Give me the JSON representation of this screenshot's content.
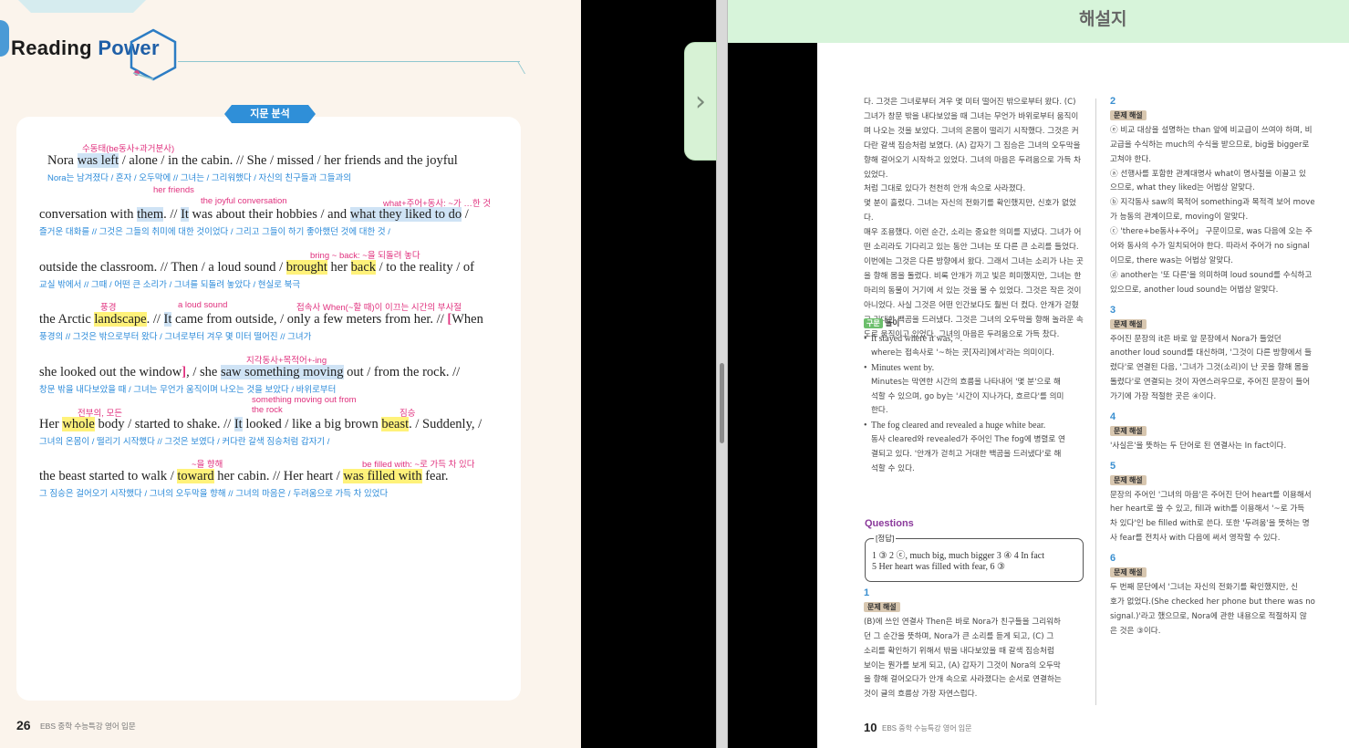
{
  "left_page": {
    "logo_reading": "Reading",
    "logo_power": "Power",
    "badge": "지문 분석",
    "lines": [
      {
        "note": "수동태(be동사+과거분사)",
        "eng": [
          "Nora ",
          "was left",
          " / alone / in the cabin. // She / missed / her friends and the joyful"
        ],
        "kor": "Nora는 남겨졌다 /          혼자 /       오두막에 //              그녀는 /  그리워했다 /   자신의 친구들과 그들과의"
      },
      {
        "note": "her friends",
        "note2": "the joyful conversation",
        "note3": "what+주어+동사: ~가 …한 것",
        "eng": [
          "conversation with ",
          "them",
          ". // ",
          "It",
          " was about their hobbies / and ",
          "what they liked to do",
          " /"
        ],
        "kor": "즐거운 대화를 //                           그것은 그들의 취미에 대한 것이었다 /              그리고 그들이 하기 좋아했던 것에 대한 것 /"
      },
      {
        "note": "bring ~ back: ~을 되돌려 놓다",
        "eng": [
          "outside the classroom. // Then / a loud sound / ",
          "brought",
          " her ",
          "back",
          " / to the reality / of"
        ],
        "kor": "교실 밖에서 //                        그때 /    어떤 큰 소리가 /          그녀를 되돌려 놓았다 /     현실로                        북극"
      },
      {
        "note": "풍경",
        "note2": "a loud sound",
        "note3": "접속사 When(~할 때)이 이끄는 시간의 부사절",
        "eng": [
          "the Arctic ",
          "landscape",
          ". // ",
          "It",
          " came from outside, / only a few meters from her. // ",
          "[",
          "When"
        ],
        "kor": "풍경의 //                                   그것은 밖으로부터 왔다 /          그녀로부터 겨우 몇 미터 떨어진 //                그녀가"
      },
      {
        "note": "지각동사+목적어+-ing",
        "eng": [
          "she looked out the window",
          "]",
          ", / she ",
          "saw something moving",
          " out / from the rock. //"
        ],
        "kor": "창문 밖을 내다보았을 때 /                          그녀는 무언가 움직이며 나오는 것을 보았다 /             바위로부터"
      },
      {
        "note": "전부의, 모든",
        "note2": "something moving out from the rock",
        "note3": "짐승",
        "eng": [
          "Her ",
          "whole",
          " body / started to shake. // ",
          "It",
          " looked / like a big brown ",
          "beast",
          ". / Suddenly, /"
        ],
        "kor": "그녀의 온몸이 /           떨리기 시작했다 //      그것은 보였다 /    커다란 갈색 짐승처럼                       갑자기 /"
      },
      {
        "note": "~을 향해",
        "note2": "be filled with: ~로 가득 차 있다",
        "eng": [
          "the beast started to walk / ",
          "toward",
          " her cabin. // Her heart / ",
          "was filled with",
          " fear."
        ],
        "kor": "그 짐승은 걸어오기 시작했다 /          그녀의 오두막을 향해 //          그녀의 마음은 /     두려움으로 가득 차 있었다"
      }
    ],
    "page_number": "26",
    "footer_text": "EBS 중학 수능특강 영어 입문"
  },
  "right_page": {
    "title": "해설지",
    "left_column": [
      "다. 그것은 그녀로부터 겨우 몇 미터 떨어진 밖으로부터 왔다. (C)",
      "그녀가 창문 밖을 내다보았을 때 그녀는 무언가 바위로부터 움직이",
      "며 나오는 것을 보았다. 그녀의 온몸이 떨리기 시작했다. 그것은 커",
      "다란 갈색 짐승처럼 보였다. (A) 갑자기 그 짐승은 그녀의 오두막을",
      "향해 걸어오기 시작하고 있었다. 그녀의 마음은 두려움으로 가득 차 있었다.",
      "처럼 그대로 있다가 천천히 안개 속으로 사라졌다.",
      "몇 분이 흘렀다. 그녀는 자신의 전화기를 확인했지만, 신호가 없었다.",
      "매우 조용했다. 이런 순간, 소리는 중요한 의미를 지녔다. 그녀가 어",
      "떤 소리라도 기다리고 있는 동안 그녀는 또 다른 큰 소리를 들었다.",
      "이번에는 그것은 다른 방향에서 왔다. 그래서 그녀는 소리가 나는 곳",
      "을 향해 몸을 돌렸다. 비록 안개가 끼고 빛은 희미했지만, 그녀는 한",
      "마리의 동물이 거기에 서 있는 것을 볼 수 있었다. 그것은 작은 것이",
      "아니었다. 사실 그것은 어떤 인간보다도 훨씬 더 컸다. 안개가 걷혔",
      "고 거대한 백곰을 드러냈다. 그것은 그녀의 오두막을 향해 놀라운 속",
      "도로 움직이고 있었다. 그녀의 마음은 두려움으로 가득 찼다."
    ],
    "gu_tag": "구문",
    "gu_title": "돌이",
    "gu_items": [
      {
        "head": "It stayed where it was, ~.",
        "body": [
          "where는 접속사로 '~하는 곳[자리]에서'라는 의미이다."
        ]
      },
      {
        "head": "Minutes went by.",
        "body": [
          "Minutes는 막연한 시간의 흐름을 나타내어 '몇 분'으로 해",
          "석할 수 있으며, go by는 '시간이 지나가다, 흐르다'를 의미",
          "한다."
        ]
      },
      {
        "head": "The fog cleared and revealed a huge white bear.",
        "body": [
          "동사 cleared와 revealed가 주어인 The fog에 병렬로 연",
          "결되고 있다. '안개가 걷히고 거대한 백곰을 드러냈다'로 해",
          "석할 수 있다."
        ]
      }
    ],
    "questions_title": "Questions",
    "answer_label": "[정답]",
    "answer_line_1": "1 ③  2 ⓒ, much big, much bigger  3 ④  4 In fact",
    "answer_line_2": "5 Her heart was filled with fear,  6 ③",
    "q1_number": "1",
    "q1_tag": "문제 해설",
    "q1_lines": [
      "(B)에 쓰인 연결사 Then은 바로 Nora가 친구들을 그리워하",
      "던 그 순간을 뜻하며, Nora가 큰 소리를 듣게 되고, (C) 그",
      "소리를 확인하기 위해서 밖을 내다보았을 때 갈색 짐승처럼",
      "보이는 뭔가를 보게 되고, (A) 갑자기 그것이 Nora의 오두막",
      "을 향해 걸어오다가 안개 속으로 사라졌다는 순서로 연결하는",
      "것이 글의 흐름상 가장 자연스럽다."
    ],
    "right_column": [
      {
        "num": "2",
        "tag": "문제 해설",
        "lines": [
          "ⓔ 비교 대상을 설명하는 than 앞에 비교급이 쓰여야 하며, 비",
          "교급을 수식하는 much의 수식을 받으므로, big을 bigger로",
          "고쳐야 한다.",
          "ⓐ 선행사를 포함한 관계대명사 what이 명사절을 이끌고 있",
          "으므로, what they liked는 어법상 알맞다.",
          "ⓑ 지각동사 saw의 목적어 something과 목적격 보어 move",
          "가 능동의 관계이므로, moving이 알맞다.",
          "ⓒ 'there+be동사+주어」 구문이므로, was 다음에 오는 주",
          "어와 동사의 수가 일치되어야 한다. 따라서 주어가 no signal",
          "이므로, there was는 어법상 알맞다.",
          "ⓓ another는 '또 다른'을 의미하며 loud sound를 수식하고",
          "있으므로, another loud sound는 어법상 알맞다."
        ]
      },
      {
        "num": "3",
        "tag": "문제 해설",
        "lines": [
          "주어진 문장의 it은 바로 앞 문장에서 Nora가 들었던",
          "another loud sound를 대신하며, '그것이 다른 방향에서 들",
          "렸다'로 연결된 다음, '그녀가 그것(소리)이 난 곳을 향해 몸을",
          "돌렸다'로 연결되는 것이 자연스러우므로, 주어진 문장이 들어",
          "가기에 가장 적절한 곳은 ④이다."
        ]
      },
      {
        "num": "4",
        "tag": "문제 해설",
        "lines": [
          "'사실은'을 뜻하는 두 단어로 된 연결사는 In fact이다."
        ]
      },
      {
        "num": "5",
        "tag": "문제 해설",
        "lines": [
          "문장의 주어인 '그녀의 마음'은 주어진 단어 heart를 이용해서",
          "her heart로 쓸 수 있고, fill과 with를 이용해서 '~로 가득",
          "차 있다'인 be filled with로 쓴다. 또한 '두려움'을 뜻하는 명",
          "사 fear를 전치사 with 다음에 써서 영작할 수 있다."
        ]
      },
      {
        "num": "6",
        "tag": "문제 해설",
        "lines": [
          "두 번째 문단에서 '그녀는 자신의 전화기를 확인했지만, 신",
          "호가 없었다.(She checked her phone but there was no",
          "signal.)'라고 했으므로, Nora에 관한 내용으로 적절하지 않",
          "은 것은 ③이다."
        ]
      }
    ],
    "page_number": "10",
    "footer_text": "EBS 중학 수능특강 영어 입문"
  },
  "nav": {
    "next_glyph": "›"
  },
  "colors": {
    "accent_blue": "#2f8fd8",
    "note_pink": "#e0317e",
    "header_green": "#d7f4da"
  }
}
